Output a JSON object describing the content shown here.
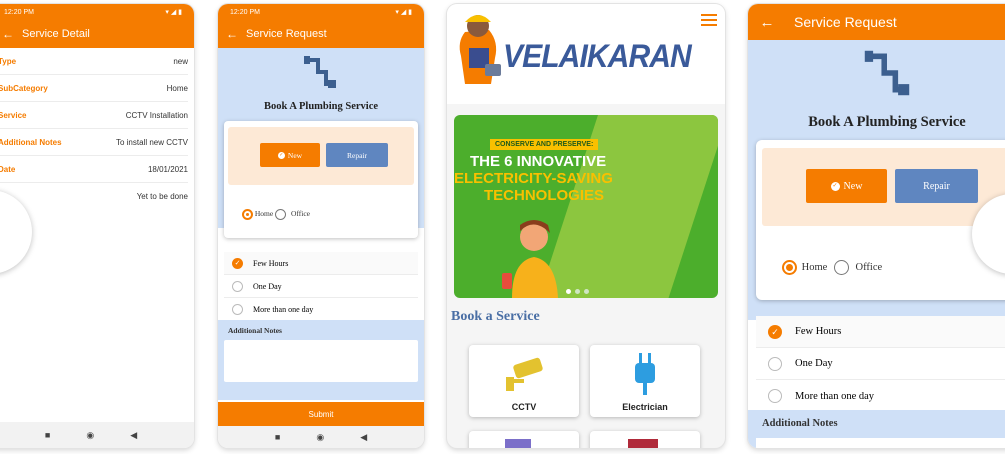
{
  "phone1": {
    "time": "12:20 PM",
    "title": "Service Detail",
    "rows": [
      {
        "label": "Type",
        "value": "new"
      },
      {
        "label": "SubCategory",
        "value": "Home"
      },
      {
        "label": "Service",
        "value": "CCTV Installation"
      },
      {
        "label": "Additional Notes",
        "value": "To install new CCTV"
      },
      {
        "label": "Date",
        "value": "18/01/2021"
      },
      {
        "label": "",
        "value": "Yet to be done"
      }
    ]
  },
  "phone2": {
    "time": "12:20 PM",
    "title": "Service Request",
    "heading": "Book A Plumbing Service",
    "new_label": "New",
    "repair_label": "Repair",
    "home_label": "Home",
    "office_label": "Office",
    "durations": [
      "Few Hours",
      "One Day",
      "More than one day"
    ],
    "notes_label": "Additional Notes",
    "submit_label": "Submit"
  },
  "phone3": {
    "brand": "VELAIKARAN",
    "banner": {
      "tag": "CONSERVE AND PRESERVE:",
      "line1": "THE 6 INNOVATIVE",
      "line2": "ELECTRICITY-SAVING",
      "line3": "TECHNOLOGIES"
    },
    "section_title": "Book a Service",
    "services": [
      "CCTV",
      "Electrician"
    ]
  },
  "phone4": {
    "title": "Service Request",
    "heading": "Book A Plumbing Service",
    "new_label": "New",
    "repair_label": "Repair",
    "home_label": "Home",
    "office_label": "Office",
    "durations": [
      "Few Hours",
      "One Day",
      "More than one day"
    ],
    "notes_label": "Additional Notes"
  },
  "colors": {
    "accent": "#f57c00",
    "repair": "#5f86c0",
    "banner_green": "#4cae2c",
    "section_blue": "#4a6fa5"
  }
}
